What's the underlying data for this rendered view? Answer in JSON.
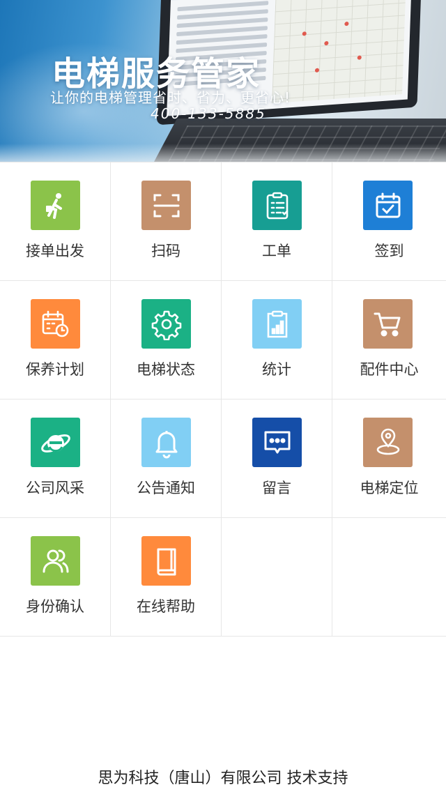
{
  "banner": {
    "title": "电梯服务管家",
    "slogan": "让你的电梯管理省时、省力、更省心!",
    "phone": "400-133-5885"
  },
  "menu": [
    {
      "label": "接单出发",
      "icon": "walking-person-icon",
      "color": "#8bc34a"
    },
    {
      "label": "扫码",
      "icon": "scan-icon",
      "color": "#c4906c"
    },
    {
      "label": "工单",
      "icon": "clipboard-checklist-icon",
      "color": "#179e93"
    },
    {
      "label": "签到",
      "icon": "calendar-check-icon",
      "color": "#1e7fd6"
    },
    {
      "label": "保养计划",
      "icon": "calendar-clock-icon",
      "color": "#ff8a3c"
    },
    {
      "label": "电梯状态",
      "icon": "gear-icon",
      "color": "#1bb185"
    },
    {
      "label": "统计",
      "icon": "clipboard-chart-icon",
      "color": "#81cff4"
    },
    {
      "label": "配件中心",
      "icon": "shopping-cart-icon",
      "color": "#c4906c"
    },
    {
      "label": "公司风采",
      "icon": "browser-e-icon",
      "color": "#1bb185"
    },
    {
      "label": "公告通知",
      "icon": "bell-icon",
      "color": "#81cff4"
    },
    {
      "label": "留言",
      "icon": "message-bubble-icon",
      "color": "#154ea8"
    },
    {
      "label": "电梯定位",
      "icon": "location-pin-icon",
      "color": "#c4906c"
    },
    {
      "label": "身份确认",
      "icon": "users-icon",
      "color": "#8bc34a"
    },
    {
      "label": "在线帮助",
      "icon": "book-icon",
      "color": "#ff8a3c"
    }
  ],
  "footer": {
    "text": "思为科技（唐山）有限公司 技术支持"
  }
}
